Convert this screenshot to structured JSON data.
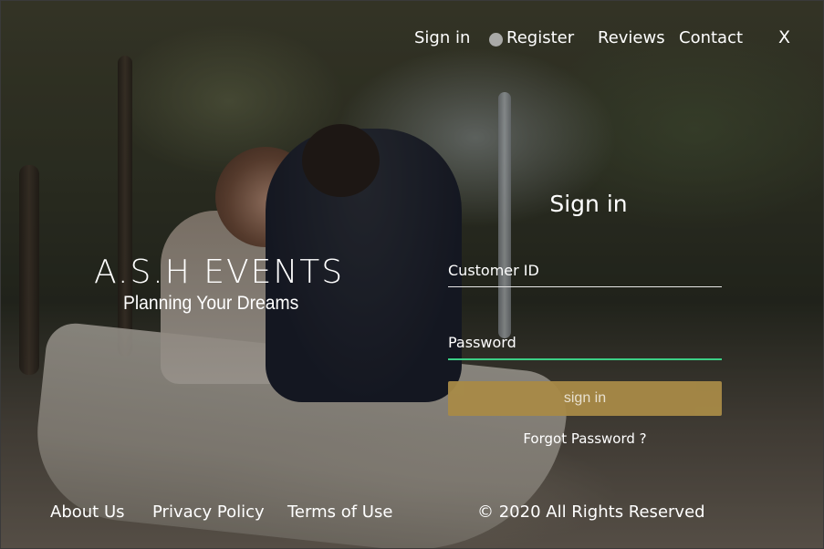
{
  "nav": {
    "items": [
      {
        "label": "Sign in"
      },
      {
        "label": "Register"
      },
      {
        "label": "Reviews"
      },
      {
        "label": "Contact"
      }
    ],
    "close_label": "X"
  },
  "brand": {
    "title": "A.S.H EVENTS",
    "tagline": "Planning Your Dreams"
  },
  "signin": {
    "title": "Sign in",
    "customer_id_placeholder": "Customer ID",
    "customer_id_value": "",
    "password_placeholder": "Password",
    "password_value": "",
    "submit_label": "sign in",
    "forgot_label": "Forgot Password ?"
  },
  "footer": {
    "links": [
      {
        "label": "About Us"
      },
      {
        "label": "Privacy Policy"
      },
      {
        "label": "Terms of Use"
      }
    ],
    "copyright": "© 2020 All Rights Reserved"
  },
  "colors": {
    "button": "#a88a47",
    "active_underline": "#3ccf86"
  }
}
